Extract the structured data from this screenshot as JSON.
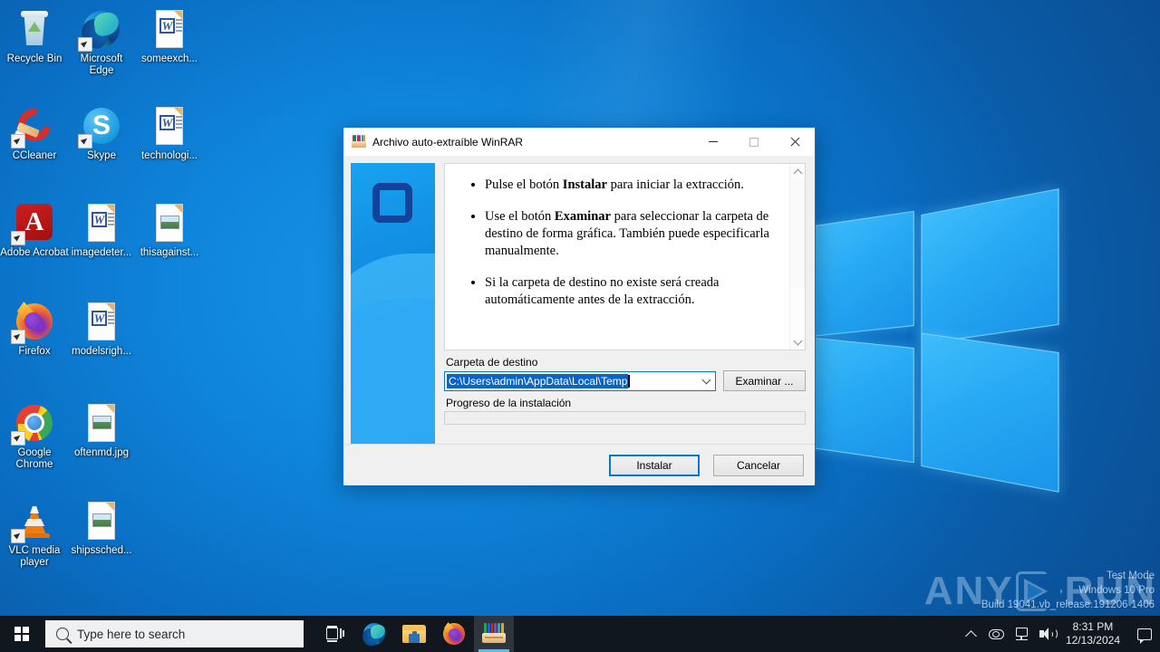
{
  "desktop": {
    "icons": [
      {
        "label": "Recycle Bin",
        "art": "recycle",
        "shortcut": false,
        "col": 0,
        "row": 0
      },
      {
        "label": "Microsoft Edge",
        "art": "edge",
        "shortcut": true,
        "col": 1,
        "row": 0
      },
      {
        "label": "someexch...",
        "art": "word-doc",
        "shortcut": false,
        "col": 2,
        "row": 0
      },
      {
        "label": "CCleaner",
        "art": "ccleaner",
        "shortcut": true,
        "col": 0,
        "row": 1
      },
      {
        "label": "Skype",
        "art": "skype",
        "shortcut": true,
        "col": 1,
        "row": 1
      },
      {
        "label": "technologi...",
        "art": "word-doc",
        "shortcut": false,
        "col": 2,
        "row": 1
      },
      {
        "label": "Adobe Acrobat",
        "art": "acrobat",
        "shortcut": true,
        "col": 0,
        "row": 2
      },
      {
        "label": "imagedeter...",
        "art": "word-doc",
        "shortcut": false,
        "col": 1,
        "row": 2
      },
      {
        "label": "thisagainst...",
        "art": "image-doc",
        "shortcut": false,
        "col": 2,
        "row": 2
      },
      {
        "label": "Firefox",
        "art": "firefox",
        "shortcut": true,
        "col": 0,
        "row": 3
      },
      {
        "label": "modelsrigh...",
        "art": "word-doc",
        "shortcut": false,
        "col": 1,
        "row": 3
      },
      {
        "label": "Google Chrome",
        "art": "chrome",
        "shortcut": true,
        "col": 0,
        "row": 4
      },
      {
        "label": "oftenmd.jpg",
        "art": "image-doc",
        "shortcut": false,
        "col": 1,
        "row": 4
      },
      {
        "label": "VLC media player",
        "art": "vlc",
        "shortcut": true,
        "col": 0,
        "row": 5
      },
      {
        "label": "shipssched...",
        "art": "image-doc",
        "shortcut": false,
        "col": 1,
        "row": 5
      }
    ],
    "watermark": {
      "brand_any": "ANY",
      "brand_run": "RUN",
      "test_mode": "Test Mode",
      "edition": "Windows 10 Pro",
      "build": "Build 19041.vb_release.191206-1406"
    }
  },
  "taskbar": {
    "start_label": "Start",
    "search_placeholder": "Type here to search",
    "search_value": "",
    "buttons": [
      {
        "name": "task-view",
        "label": "Task View"
      },
      {
        "name": "edge",
        "label": "Microsoft Edge"
      },
      {
        "name": "explorer",
        "label": "File Explorer"
      },
      {
        "name": "firefox",
        "label": "Firefox"
      },
      {
        "name": "winrar",
        "label": "WinRAR self-extracting archive",
        "active": true
      }
    ],
    "tray": {
      "show_hidden": "Show hidden icons",
      "onedrive": "OneDrive",
      "network": "Network",
      "volume": "Volume",
      "time": "8:31 PM",
      "date": "12/13/2024",
      "notifications": "Notifications"
    }
  },
  "dialog": {
    "title": "Archivo auto-extraíble WinRAR",
    "controls": {
      "minimize": "Minimizar",
      "maximize": "Maximizar",
      "close": "Cerrar"
    },
    "info": {
      "bullet1_pre": "Pulse el botón ",
      "bullet1_bold": "Instalar",
      "bullet1_post": " para iniciar la extracción.",
      "bullet2_pre": "Use el botón ",
      "bullet2_bold": "Examinar",
      "bullet2_post": " para seleccionar la carpeta de destino de forma gráfica. También puede especificarla manualmente.",
      "bullet3": "Si la carpeta de destino no existe será creada automáticamente antes de la extracción."
    },
    "dest_label": "Carpeta de destino",
    "dest_value": "C:\\Users\\admin\\AppData\\Local\\Temp",
    "dest_placeholder": "C:\\",
    "browse_label": "Examinar ...",
    "progress_label": "Progreso de la instalación",
    "progress_percent": 0,
    "install_label": "Instalar",
    "cancel_label": "Cancelar"
  }
}
